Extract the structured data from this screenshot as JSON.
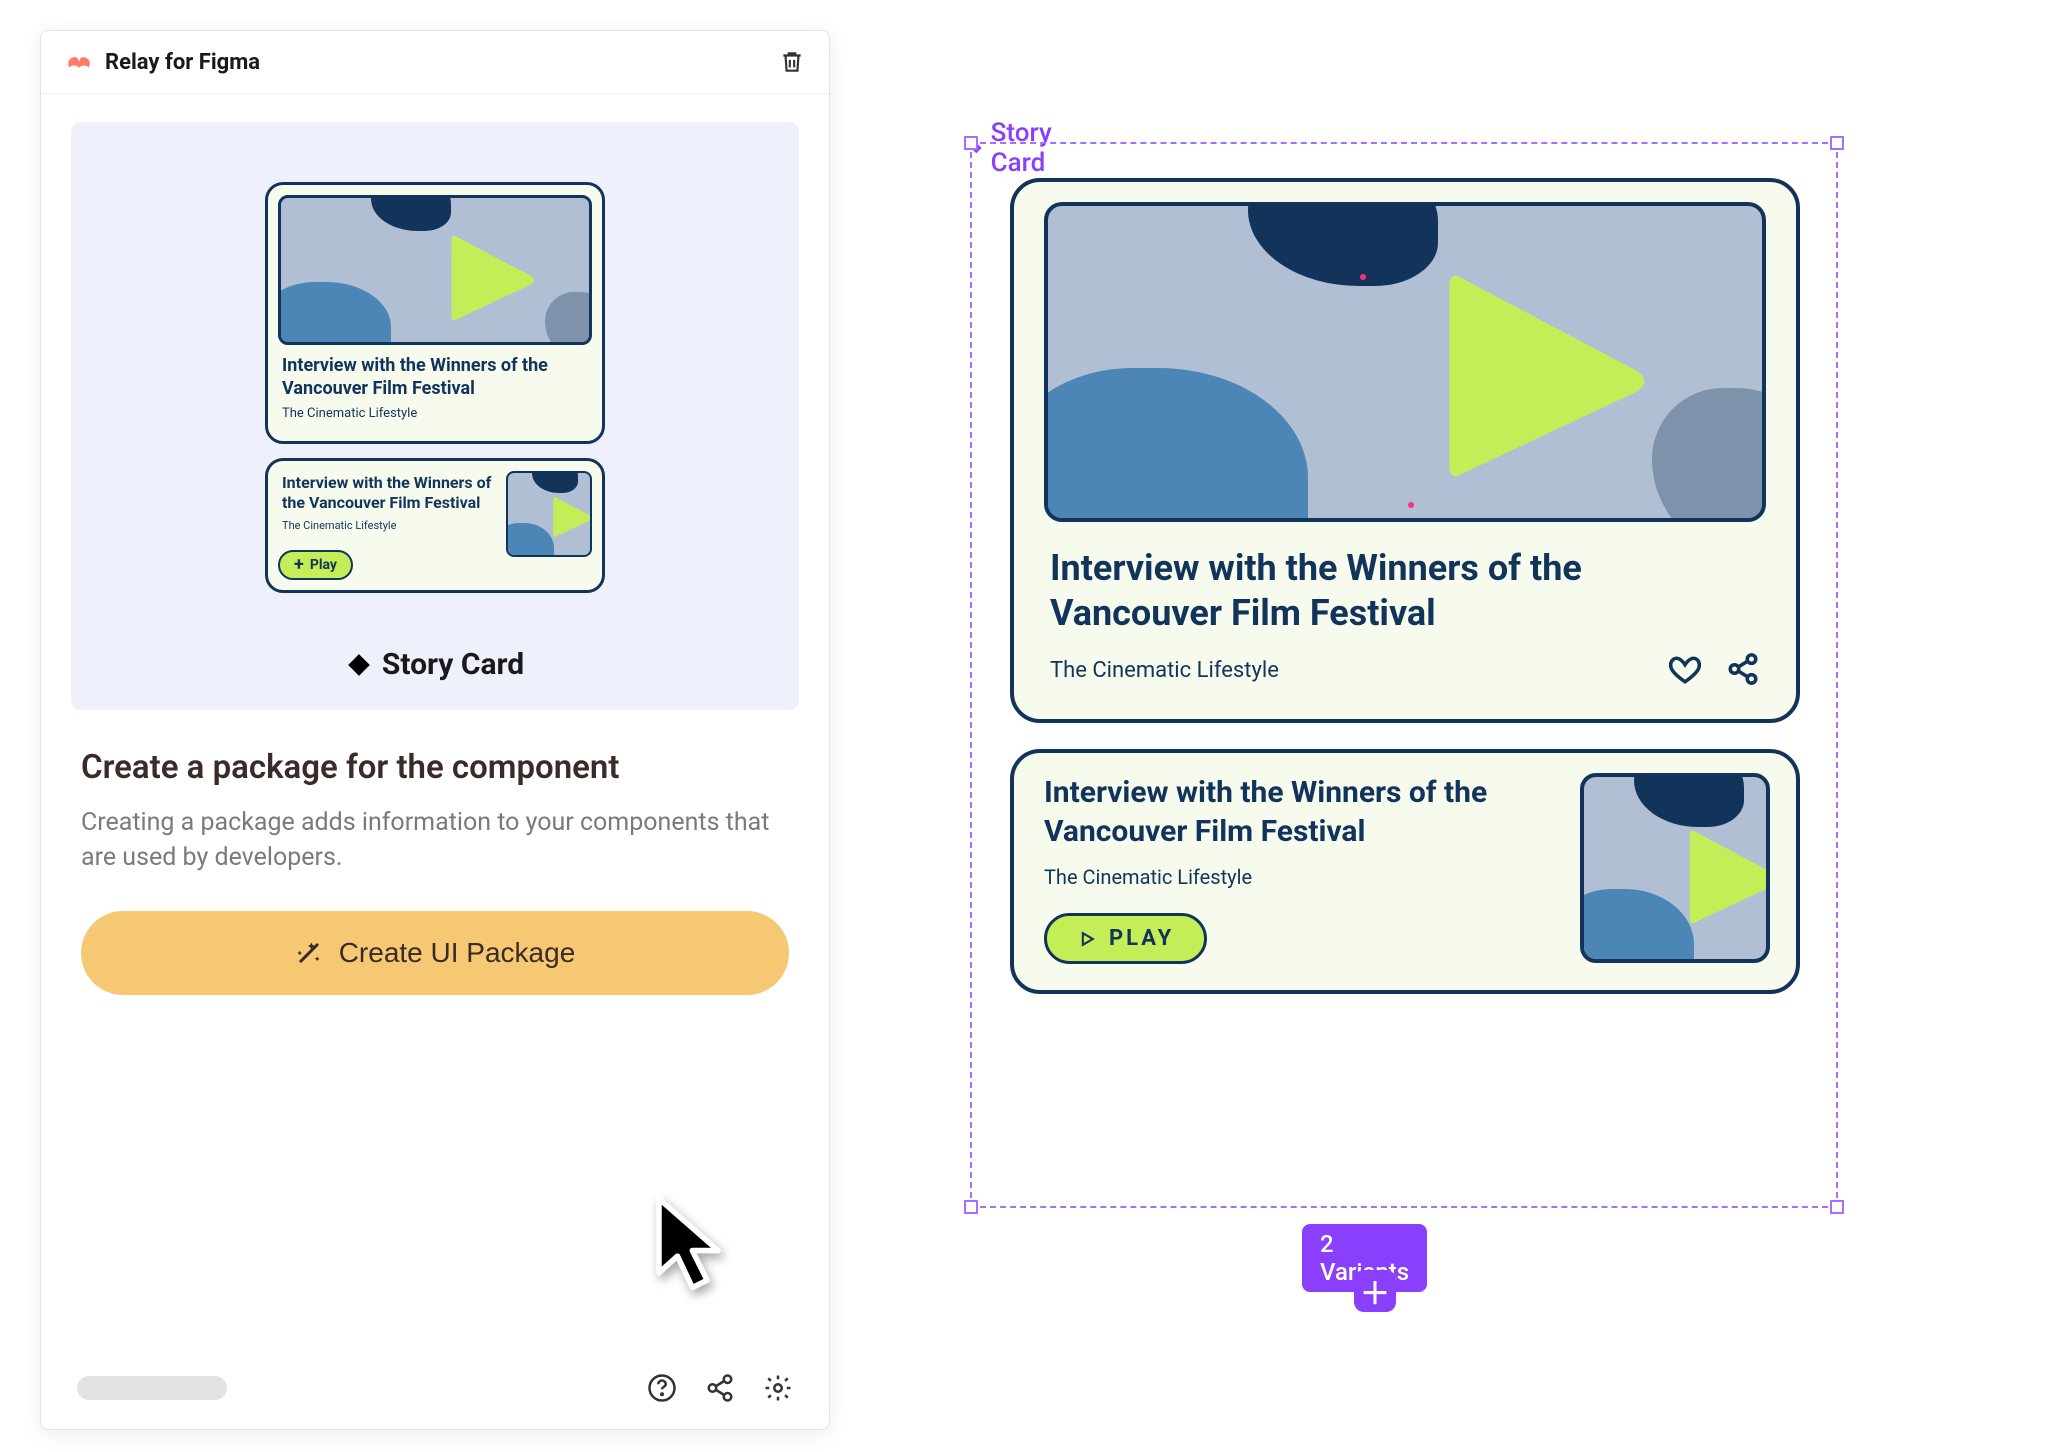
{
  "panel": {
    "title": "Relay for Figma",
    "component_name": "Story Card",
    "desc_title": "Create a package for the component",
    "desc_text": "Creating a package adds information to your components that are used by developers.",
    "create_button": "Create UI Package"
  },
  "preview": {
    "card_title": "Interview with the Winners of the Vancouver Film Festival",
    "card_subtitle": "The Cinematic Lifestyle",
    "play_label": "Play"
  },
  "canvas": {
    "label": "Story Card",
    "variants_badge": "2 Variants",
    "card_title": "Interview with the Winners of the Vancouver Film Festival",
    "card_subtitle": "The Cinematic Lifestyle",
    "play_label": "PLAY"
  },
  "colors": {
    "accent": "#c4ee57",
    "brand_dark": "#13345a",
    "figma_purple": "#8a3ffc",
    "warm_button": "#f7c873"
  }
}
